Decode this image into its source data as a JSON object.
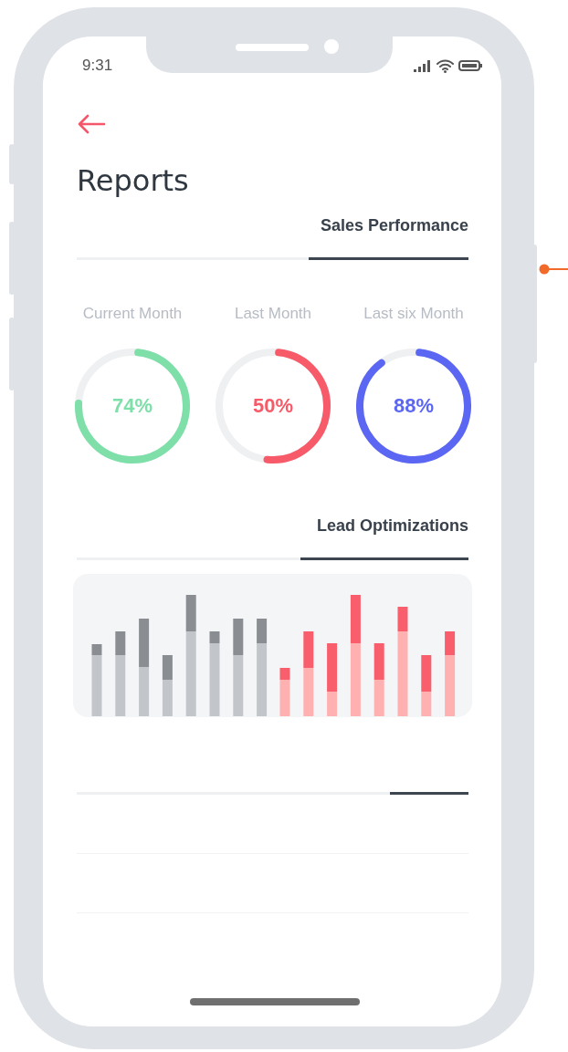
{
  "status_bar": {
    "time": "9:31"
  },
  "header": {
    "title": "Reports"
  },
  "sales_performance": {
    "tab": "Sales Performance",
    "selected": true,
    "metrics": [
      {
        "label": "Current Month",
        "value": "74%",
        "level": 0.74,
        "color": "#7edfa9"
      },
      {
        "label": "Last Month",
        "value": "50%",
        "level": 0.5,
        "color": "#f75b69"
      },
      {
        "label": "Last six Month",
        "value": "88%",
        "level": 0.88,
        "color": "#5b67f3"
      }
    ]
  },
  "lead_optimizations": {
    "tab": "Lead Optimizations",
    "selected": true
  }
}
